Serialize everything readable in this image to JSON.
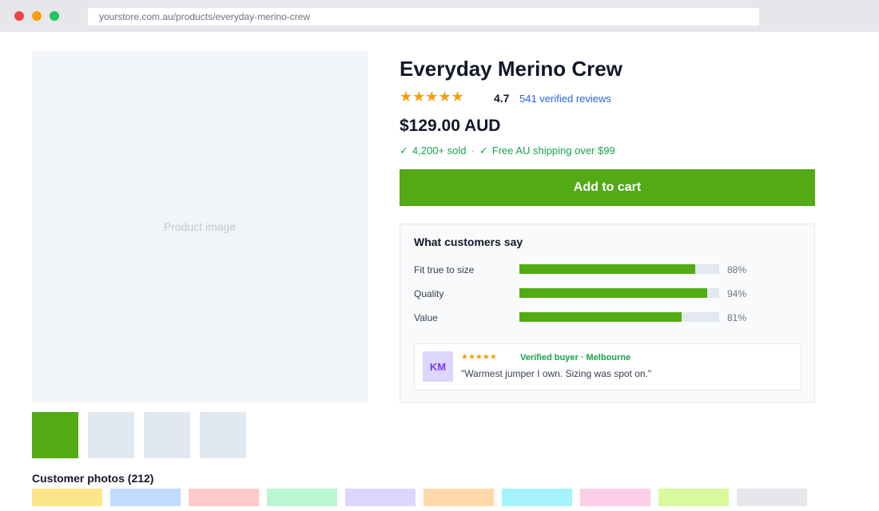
{
  "browser": {
    "url": "yourstore.com.au/products/everyday-merino-crew"
  },
  "gallery": {
    "main_image_label": "Product image",
    "thumbnails": [
      {
        "active": true,
        "color": "#52aa15"
      },
      {
        "active": false,
        "color": "#e2e8f0"
      },
      {
        "active": false,
        "color": "#e2e8f0"
      },
      {
        "active": false,
        "color": "#e2e8f0"
      }
    ]
  },
  "customer_photos": {
    "heading": "Customer photos (212)",
    "swatches": [
      "#fde68a",
      "#bfdbfe",
      "#fecaca",
      "#bbf7d0",
      "#ddd6fe",
      "#fed7aa",
      "#a5f3fc",
      "#fbcfe8",
      "#d9f99d",
      "#e5e7eb"
    ]
  },
  "product": {
    "title": "Everyday Merino Crew",
    "stars": "★★★★★",
    "rating": "4.7",
    "reviews_link": "541 verified reviews",
    "price": "$129.00 AUD",
    "trust": {
      "check": "✓",
      "sold": "4,200+ sold",
      "separator": "·",
      "shipping": "Free AU shipping over $99"
    },
    "add_to_cart_label": "Add to cart"
  },
  "customer_panel": {
    "title": "What customers say",
    "metrics": [
      {
        "label": "Fit true to size",
        "percent": 88,
        "percent_label": "88%"
      },
      {
        "label": "Quality",
        "percent": 94,
        "percent_label": "94%"
      },
      {
        "label": "Value",
        "percent": 81,
        "percent_label": "81%"
      }
    ],
    "review": {
      "initials": "KM",
      "stars": "★★★★★",
      "verified": "Verified buyer · Melbourne",
      "quote": "\"Warmest jumper I own. Sizing was spot on.\""
    }
  },
  "colors": {
    "accent": "#52aa15",
    "star": "#f59e0b",
    "link": "#2563eb",
    "success": "#16a34a"
  }
}
